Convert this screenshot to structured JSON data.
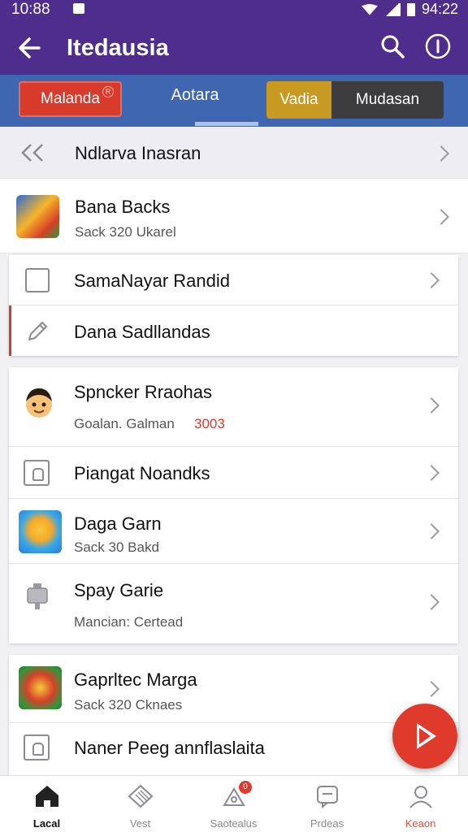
{
  "status": {
    "time": "10:88",
    "clock_right": "94:22"
  },
  "appbar": {
    "title": "Itedausia"
  },
  "tabs": {
    "pill_label": "Malanda",
    "pill_badge": "R",
    "middle_label": "Aotara",
    "segment_left": "Vadia",
    "segment_right": "Mudasan"
  },
  "list": {
    "header_row": {
      "label": "Ndlarva Inasran"
    },
    "row1": {
      "title": "Bana Backs",
      "subtitle": "Sack 320 Ukarel"
    },
    "card1": [
      {
        "title": "SamaNayar Randid"
      },
      {
        "title": "Dana Sadllandas"
      }
    ],
    "card2": {
      "row_a": {
        "title": "Spncker Rraohas",
        "subtitle": "Goalan. Galman",
        "highlight": "3003"
      },
      "row_b": {
        "title": "Piangat Noandks"
      },
      "row_c": {
        "title": "Daga Garn",
        "subtitle": "Sack 30 Bakd"
      },
      "row_d": {
        "title": "Spay Garie",
        "subtitle": "Mancian: Certead"
      }
    },
    "card3": {
      "row_a": {
        "title": "Gaprltec Marga",
        "subtitle": "Sack 320 Cknaes"
      },
      "row_b": {
        "title": "Naner Peeg annflaslaita"
      }
    }
  },
  "bottom_nav": [
    {
      "label": "Lacal",
      "icon": "home-icon"
    },
    {
      "label": "Vest",
      "icon": "grid-icon"
    },
    {
      "label": "Saotealus",
      "icon": "notification-icon",
      "badge": "0"
    },
    {
      "label": "Prdeas",
      "icon": "chat-icon"
    },
    {
      "label": "Keaon",
      "icon": "profile-icon"
    }
  ],
  "colors": {
    "primary": "#4e2d8c",
    "tab_bg": "#3f66b0",
    "accent_red": "#e03a2c",
    "accent_gold": "#c89a22"
  }
}
